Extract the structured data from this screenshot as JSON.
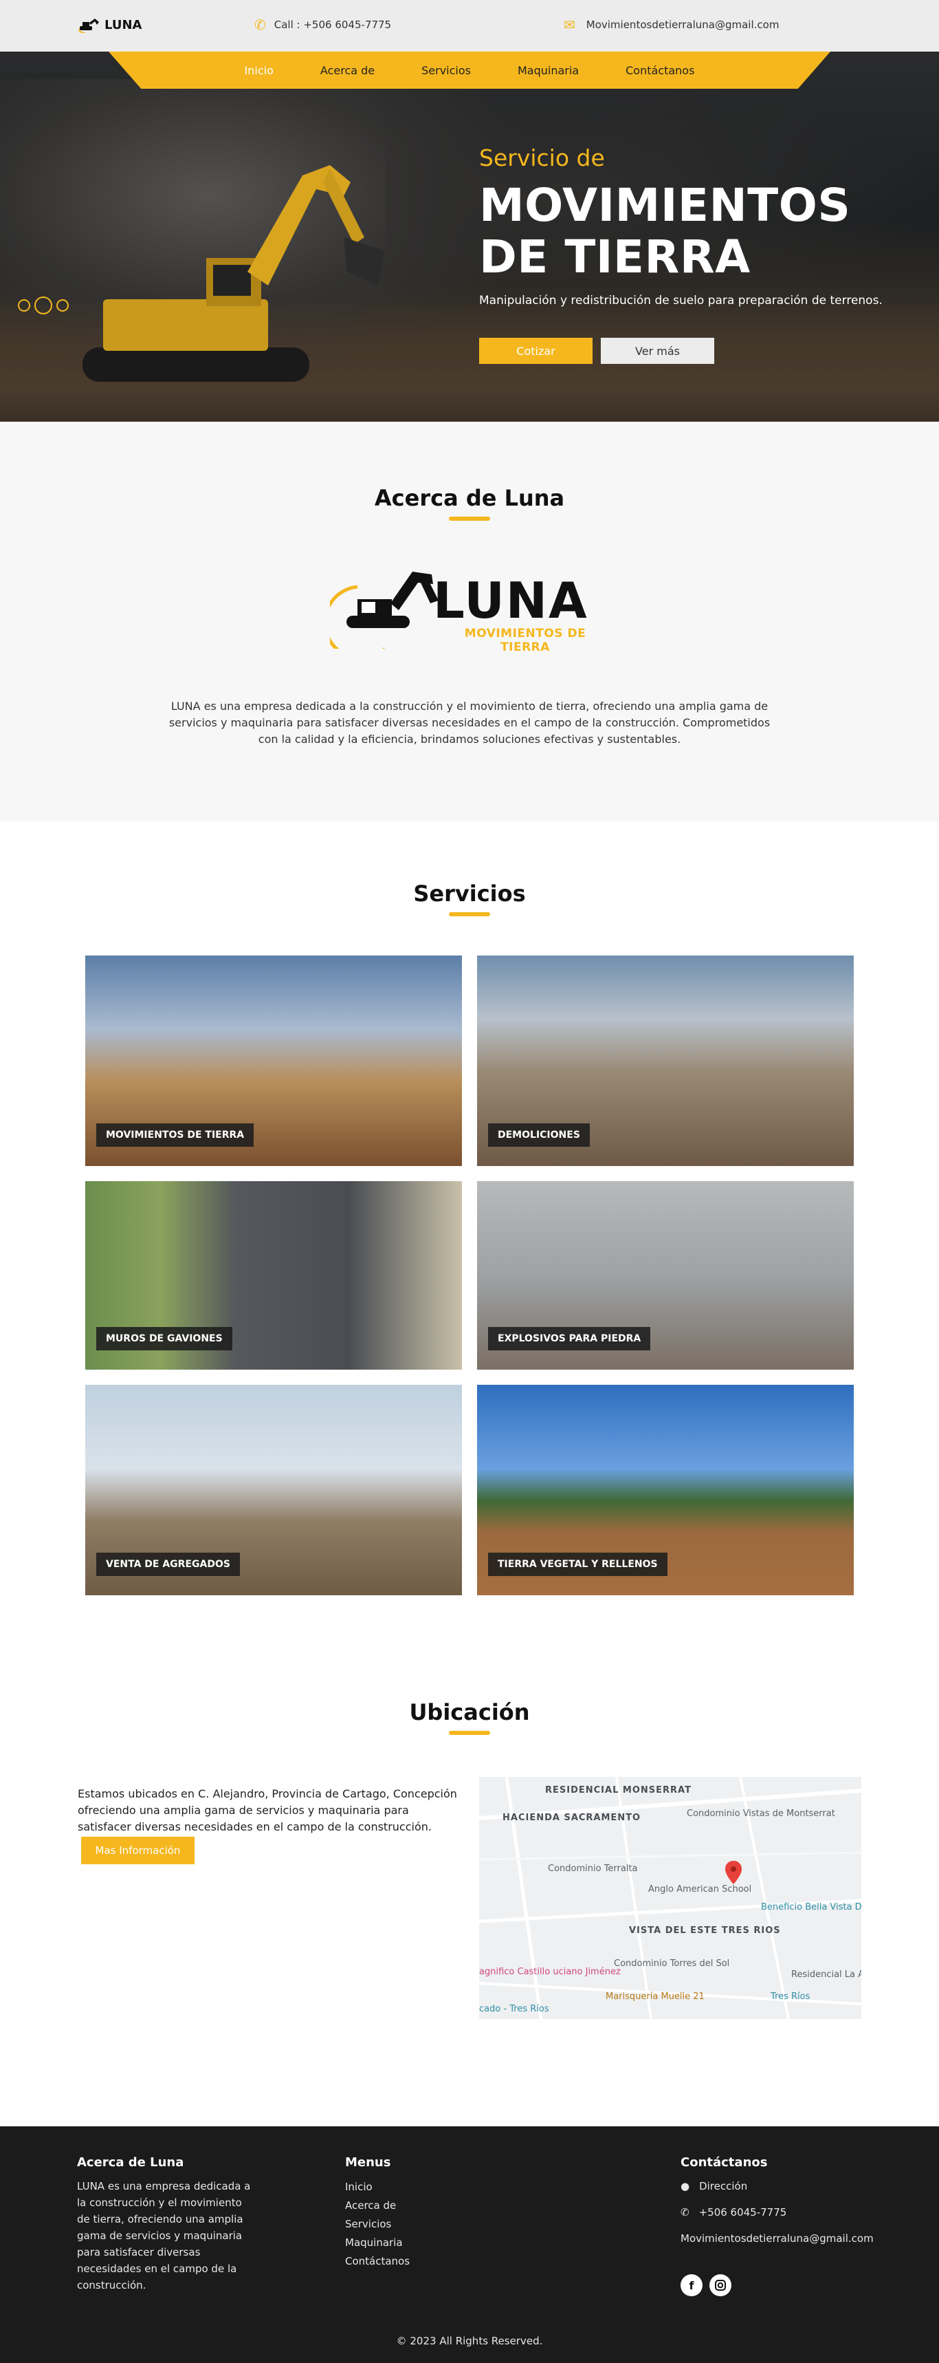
{
  "brand": {
    "name": "LUNA"
  },
  "topbar": {
    "call": "Call : +506 6045-7775",
    "email": "Movimientosdetierraluna@gmail.com"
  },
  "nav": [
    {
      "label": "Inicio"
    },
    {
      "label": "Acerca de"
    },
    {
      "label": "Servicios"
    },
    {
      "label": "Maquinaria"
    },
    {
      "label": "Contáctanos"
    }
  ],
  "hero": {
    "subtitle": "Servicio de",
    "title_line1": "MOVIMIENTOS",
    "title_line2": "DE TIERRA",
    "description": "Manipulación y redistribución de suelo para preparación de terrenos.",
    "btn_quote": "Cotizar",
    "btn_more": "Ver más"
  },
  "about": {
    "title": "Acerca de Luna",
    "logo_main": "LUNA",
    "logo_sub": "MOVIMIENTOS DE TIERRA",
    "text": "LUNA es una empresa dedicada a la construcción y el movimiento de tierra, ofreciendo una amplia gama de servicios y maquinaria para satisfacer diversas necesidades en el campo de la construcción. Comprometidos con la calidad y la eficiencia, brindamos soluciones efectivas y sustentables."
  },
  "services": {
    "title": "Servicios",
    "items": [
      {
        "label": "MOVIMIENTOS DE TIERRA"
      },
      {
        "label": "DEMOLICIONES"
      },
      {
        "label": "MUROS DE GAVIONES"
      },
      {
        "label": "EXPLOSIVOS PARA PIEDRA"
      },
      {
        "label": "VENTA DE AGREGADOS"
      },
      {
        "label": "TIERRA VEGETAL Y RELLENOS"
      }
    ]
  },
  "location": {
    "title": "Ubicación",
    "text": "Estamos ubicados en C. Alejandro, Provincia de Cartago, Concepción ofreciendo una amplia gama de servicios y maquinaria para satisfacer diversas necesidades en el campo de la construcción.",
    "btn": "Mas Información",
    "map_labels": {
      "monserrat": "RESIDENCIAL MONSERRAT",
      "sacramento": "HACIENDA SACRAMENTO",
      "vistas": "Condominio Vistas de Montserrat",
      "terralta": "Condominio Terralta",
      "anglo": "Anglo American School",
      "bella": "Beneficio Bella Vista Dulce Nombre",
      "vista_este": "VISTA DEL ESTE TRES RIOS",
      "torres": "Condominio Torres del Sol",
      "castillo": "agnifico Castillo uciano Jiménez",
      "marisqueria": "Marisquería Muelle 21",
      "residencial_la": "Residencial La A",
      "tres_rios": "Tres Ríos",
      "cado": "cado - Tres Ríos"
    }
  },
  "footer": {
    "about_title": "Acerca de Luna",
    "about_text": "LUNA es una empresa dedicada a la construcción y el movimiento de tierra, ofreciendo una amplia gama de servicios y maquinaria para satisfacer diversas necesidades en el campo de la construcción.",
    "menus_title": "Menus",
    "menus": [
      {
        "label": "Inicio"
      },
      {
        "label": "Acerca de"
      },
      {
        "label": "Servicios"
      },
      {
        "label": "Maquinaria"
      },
      {
        "label": "Contáctanos"
      }
    ],
    "contact_title": "Contáctanos",
    "address": "Dirección",
    "phone": "+506 6045-7775",
    "email": "Movimientosdetierraluna@gmail.com",
    "copyright": "© 2023 All Rights Reserved."
  },
  "colors": {
    "accent": "#f5b71d",
    "dark": "#1b1b1b",
    "light_bg": "#f7f7f7"
  }
}
